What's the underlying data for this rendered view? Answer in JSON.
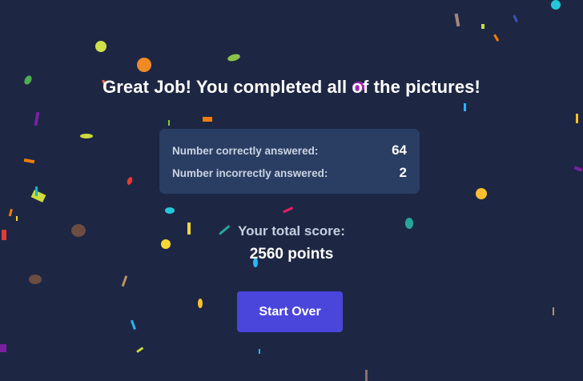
{
  "result": {
    "title": "Great Job! You completed all of the pictures!",
    "stats": [
      {
        "label": "Number correctly answered:",
        "value": "64"
      },
      {
        "label": "Number incorrectly answered:",
        "value": "2"
      }
    ],
    "score_label": "Your total score:",
    "score_value": "2560 points",
    "start_over_label": "Start Over"
  },
  "colors": {
    "background": "#1d2744",
    "card": "#2a3d63",
    "button": "#4a46dc"
  },
  "decoration": "confetti"
}
